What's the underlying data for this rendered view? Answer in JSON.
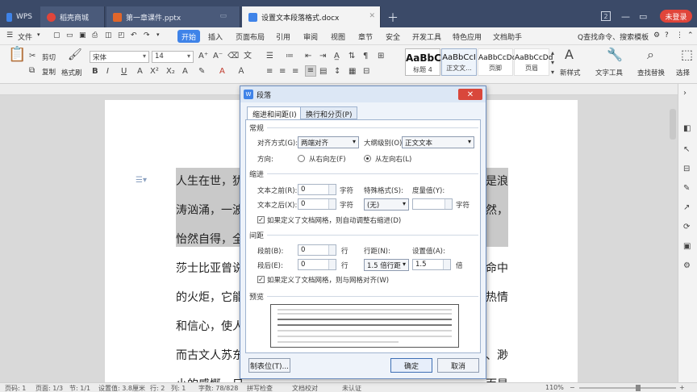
{
  "tabs": [
    {
      "label": "WPS",
      "color": "#3f83e8"
    },
    {
      "label": "稻壳商城",
      "color": "#e0453a"
    },
    {
      "label": "第一章课件.pptx",
      "color": "#e0662a"
    },
    {
      "label": "设置文本段落格式.docx",
      "color": "#3f83e8"
    }
  ],
  "titlebar": {
    "badge": "2",
    "login": "未登录"
  },
  "menu": {
    "file": "文件",
    "items": [
      "开始",
      "插入",
      "页面布局",
      "引用",
      "审阅",
      "视图",
      "章节",
      "安全",
      "开发工具",
      "特色应用",
      "文档助手"
    ],
    "search": "Q查找命令、搜索模板"
  },
  "ribbon": {
    "cut": "剪切",
    "copy": "复制",
    "format_painter": "格式刷",
    "font_name": "宋体",
    "font_size": "14",
    "styles": [
      {
        "sample": "AaBbC",
        "name": "标题 4"
      },
      {
        "sample": "AaBbCcI",
        "name": "正文文..."
      },
      {
        "sample": "AaBbCcDd",
        "name": "页脚"
      },
      {
        "sample": "AaBbCcDd",
        "name": "页眉"
      }
    ],
    "new_style": "新样式",
    "text_tools": "文字工具",
    "find_replace": "查找替换",
    "select": "选择"
  },
  "document": {
    "paragraphs": [
      {
        "text": "人生在世，犹",
        "tail": "是浪",
        "highlight": true
      },
      {
        "text": "涛汹涌，一波",
        "tail": "然，",
        "highlight": true
      },
      {
        "text": "怡然自得，全",
        "tail": "",
        "highlight": true
      },
      {
        "text": "莎士比亚曾说",
        "tail": "命中",
        "highlight": false
      },
      {
        "text": "的火炬，它能",
        "tail": "热情",
        "highlight": false
      },
      {
        "text": "和信心，使人",
        "tail": "",
        "highlight": false
      },
      {
        "text": "而古文人苏东",
        "tail": "、渺",
        "highlight": false
      },
      {
        "text": "小的感慨，只",
        "tail": "而是",
        "highlight": false
      }
    ]
  },
  "dialog": {
    "title": "段落",
    "close": "✕",
    "tabs": [
      "缩进和间距(I)",
      "换行和分页(P)"
    ],
    "general": {
      "section": "常规",
      "align_label": "对齐方式(G):",
      "align_value": "两端对齐",
      "outline_label": "大纲级别(O):",
      "outline_value": "正文文本",
      "direction_label": "方向:",
      "rtl": "从右向左(F)",
      "ltr": "从左向右(L)"
    },
    "indent": {
      "section": "缩进",
      "before_label": "文本之前(R):",
      "before_value": "0",
      "after_label": "文本之后(X):",
      "after_value": "0",
      "unit": "字符",
      "special_label": "特殊格式(S):",
      "special_value": "(无)",
      "measure_label": "度量值(Y):",
      "measure_unit": "字符",
      "grid_check": "如果定义了文档网格，则自动调整右缩进(D)"
    },
    "spacing": {
      "section": "间距",
      "before_label": "段前(B):",
      "before_value": "0",
      "after_label": "段后(E):",
      "after_value": "0",
      "unit": "行",
      "line_label": "行距(N):",
      "line_value": "1.5 倍行距",
      "setting_label": "设置值(A):",
      "setting_value": "1.5",
      "setting_unit": "倍",
      "grid_check": "如果定义了文档网格，则与网格对齐(W)"
    },
    "preview_label": "预览",
    "tabs_button": "制表位(T)...",
    "ok": "确定",
    "cancel": "取消"
  },
  "statusbar": {
    "page": "页码: 1",
    "pages": "页面: 1/3",
    "section": "节: 1/1",
    "position": "设置值: 3.8厘米",
    "row": "行: 2",
    "col": "列: 1",
    "words": "字数: 78/828",
    "spell": "拼写检查",
    "proof": "文档校对",
    "cert": "未认证",
    "zoom": "110%"
  }
}
